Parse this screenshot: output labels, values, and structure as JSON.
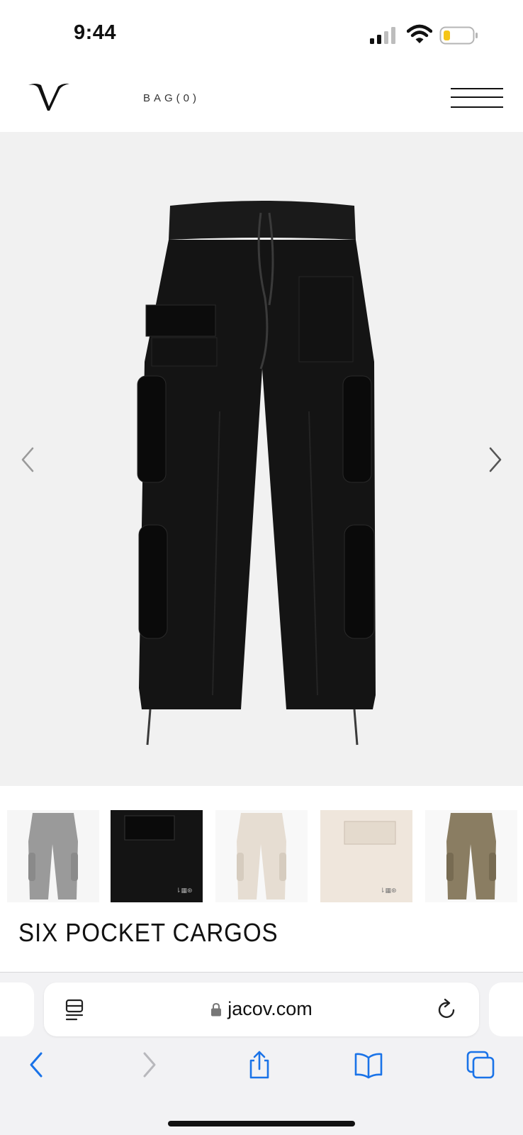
{
  "status_bar": {
    "time": "9:44",
    "signal_icon": "cellular-signal-icon",
    "wifi_icon": "wifi-icon",
    "battery_icon": "battery-low-icon",
    "battery_color": "#f5c518"
  },
  "header": {
    "logo_icon": "jacov-v-logo",
    "bag_label": "BAG(0)",
    "menu_icon": "hamburger-menu-icon"
  },
  "gallery": {
    "background": "#f1f1f1",
    "prev_icon": "chevron-left-icon",
    "next_icon": "chevron-right-icon",
    "main_image": "black cargo pants",
    "thumbnails": [
      {
        "description": "grey cargo pants",
        "color": "#9a9a9a"
      },
      {
        "description": "black pocket detail",
        "color": "#141414"
      },
      {
        "description": "cream cargo pants",
        "color": "#e6ddd2"
      },
      {
        "description": "cream pocket detail",
        "color": "#efe6dc"
      },
      {
        "description": "khaki cargo pants",
        "color": "#8a7d62"
      }
    ]
  },
  "product": {
    "title": "SIX POCKET CARGOS"
  },
  "browser": {
    "url": "jacov.com",
    "reader_icon": "reader-mode-icon",
    "lock_icon": "lock-icon",
    "reload_icon": "reload-icon",
    "accent": "#1a73e8",
    "nav": {
      "back_icon": "back-icon",
      "forward_icon": "forward-icon",
      "share_icon": "share-icon",
      "bookmarks_icon": "bookmarks-icon",
      "tabs_icon": "tabs-icon"
    }
  }
}
